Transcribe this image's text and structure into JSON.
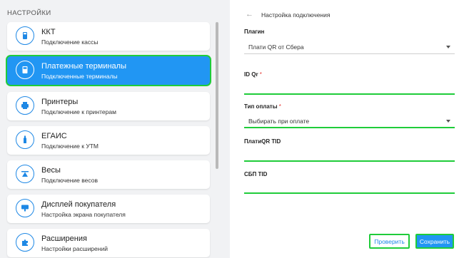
{
  "sidebar": {
    "title": "НАСТРОЙКИ",
    "items": [
      {
        "title": "ККТ",
        "subtitle": "Подключение кассы",
        "icon": "cash-register-icon"
      },
      {
        "title": "Платежные терминалы",
        "subtitle": "Подключенные терминалы",
        "icon": "payment-terminal-icon"
      },
      {
        "title": "Принтеры",
        "subtitle": "Подключение к принтерам",
        "icon": "printer-icon"
      },
      {
        "title": "ЕГАИС",
        "subtitle": "Подключение к УТМ",
        "icon": "bottle-icon"
      },
      {
        "title": "Весы",
        "subtitle": "Подключение весов",
        "icon": "scales-icon"
      },
      {
        "title": "Дисплей покупателя",
        "subtitle": "Настройка экрана покупателя",
        "icon": "display-icon"
      },
      {
        "title": "Расширения",
        "subtitle": "Настройки расширений",
        "icon": "puzzle-icon"
      }
    ],
    "active_index": 1
  },
  "panel": {
    "back_icon": "←",
    "title": "Настройка подключения",
    "fields": {
      "plugin": {
        "label": "Плагин",
        "value": "Плати QR от Сбера"
      },
      "id_qr": {
        "label": "ID Qr",
        "required_mark": "*",
        "value": ""
      },
      "payment_type": {
        "label": "Тип оплаты",
        "required_mark": "*",
        "value": "Выбирать при оплате"
      },
      "platiqr_tid": {
        "label": "ПлатиQR TID",
        "value": ""
      },
      "sbp_tid": {
        "label": "СБП TID",
        "value": ""
      }
    },
    "buttons": {
      "check": "Проверить",
      "save": "Сохранить"
    }
  },
  "colors": {
    "accent": "#2196f3",
    "highlight": "#1fcc3a",
    "required": "#e53935"
  }
}
